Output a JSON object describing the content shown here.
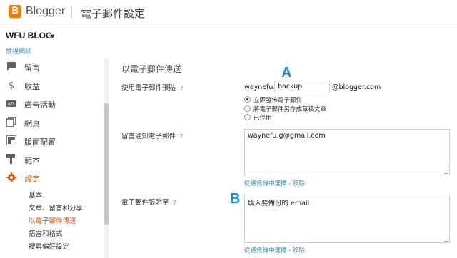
{
  "header": {
    "brand": "Blogger",
    "title": "電子郵件設定"
  },
  "sidebar": {
    "blog_name": "WFU BLOG",
    "caret": "▼",
    "view_blog": "檢視網誌",
    "items": [
      {
        "label": "留言",
        "icon": "comment-icon"
      },
      {
        "label": "收益",
        "icon": "dollar-icon"
      },
      {
        "label": "廣告活動",
        "icon": "ad-icon"
      },
      {
        "label": "網頁",
        "icon": "pages-icon"
      },
      {
        "label": "版面配置",
        "icon": "layout-icon"
      },
      {
        "label": "範本",
        "icon": "theme-icon"
      },
      {
        "label": "設定",
        "icon": "gear-icon",
        "active": true
      }
    ],
    "sub_items": [
      {
        "label": "基本"
      },
      {
        "label": "文章、留言和分享"
      },
      {
        "label": "以電子郵件傳送",
        "active": true
      },
      {
        "label": "語言和格式"
      },
      {
        "label": "搜尋偏好設定"
      }
    ],
    "accent": "#e65100"
  },
  "main": {
    "section_title": "以電子郵件傳送",
    "post_by_email": {
      "label": "使用電子郵件張貼",
      "help": "?",
      "prefix": "waynefu.g",
      "secret_value": "backup",
      "suffix": "@blogger.com",
      "options": [
        {
          "label": "立即發佈電子郵件",
          "checked": true
        },
        {
          "label": "將電子郵件另存成草稿文章",
          "checked": false
        },
        {
          "label": "已停用",
          "checked": false
        }
      ]
    },
    "comment_notify": {
      "label": "留言通知電子郵件",
      "help": "?",
      "value": "waynefu.g@gmail.com",
      "link": "從通訊錄中選擇 - 移除"
    },
    "post_notify": {
      "label": "電子郵件張貼至",
      "help": "?",
      "value": "填入要備份的 email",
      "link": "從通訊錄中選擇 - 移除"
    }
  },
  "annotations": {
    "a": "A",
    "b": "B",
    "color": "#1e88e5"
  },
  "colors": {
    "link": "#3c8fa5",
    "brand_orange": "#f57c00"
  }
}
